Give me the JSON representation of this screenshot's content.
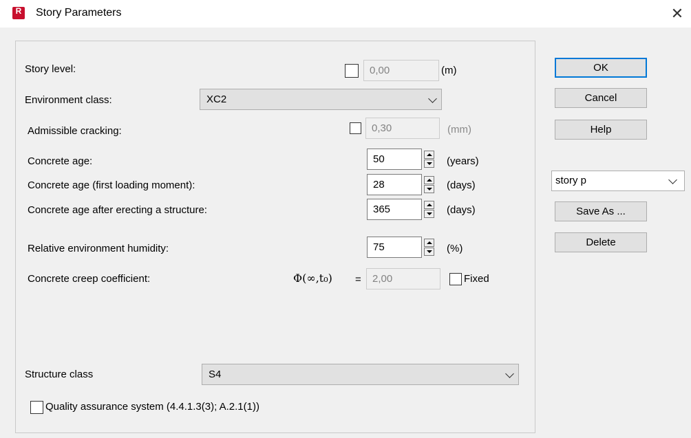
{
  "window": {
    "title": "Story Parameters",
    "app_icon_letter": "R",
    "close_glyph": "✕"
  },
  "form": {
    "story_level": {
      "label": "Story level:",
      "value": "0,00",
      "unit": "(m)"
    },
    "environment_class": {
      "label": "Environment class:",
      "selected": "XC2"
    },
    "admissible_cracking": {
      "label": "Admissible cracking:",
      "value": "0,30",
      "unit": "(mm)"
    },
    "concrete_age": {
      "label": "Concrete age:",
      "value": "50",
      "unit": "(years)"
    },
    "first_loading": {
      "label": "Concrete age (first loading moment):",
      "value": "28",
      "unit": "(days)"
    },
    "after_erecting": {
      "label": "Concrete age after erecting a structure:",
      "value": "365",
      "unit": "(days)"
    },
    "humidity": {
      "label": "Relative environment humidity:",
      "value": "75",
      "unit": "(%)"
    },
    "creep": {
      "label": "Concrete creep coefficient:",
      "symbol": "Φ(∞,t₀)",
      "equals": "=",
      "value": "2,00",
      "fixed_label": "Fixed"
    },
    "structure_class": {
      "label": "Structure class",
      "selected": "S4"
    },
    "quality": {
      "label": "Quality assurance system (4.4.1.3(3); A.2.1(1))"
    }
  },
  "buttons": {
    "ok": "OK",
    "cancel": "Cancel",
    "help": "Help",
    "save_as": "Save As ...",
    "delete": "Delete"
  },
  "preset": {
    "selected": "story p"
  },
  "colors": {
    "accent": "#0078d7",
    "icon": "#c8102e"
  }
}
